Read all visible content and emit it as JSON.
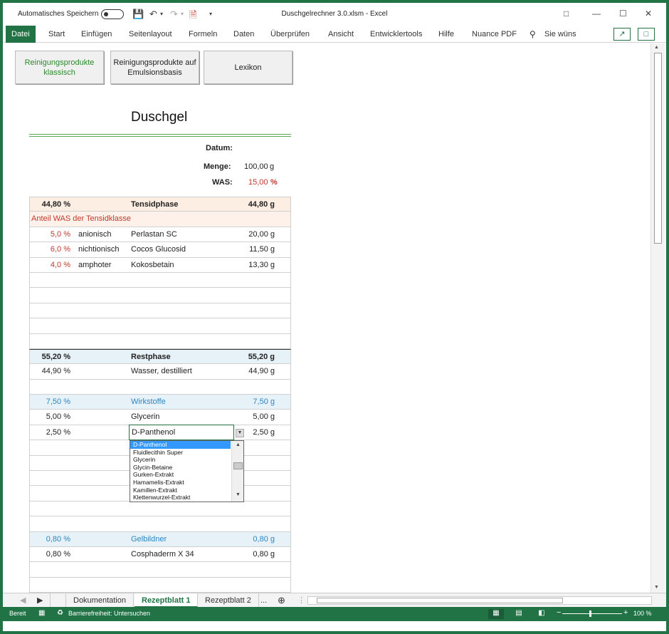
{
  "titlebar": {
    "autosave_label": "Automatisches Speichern",
    "title": "Duschgelrechner 3.0.xlsm  -  Excel"
  },
  "ribbon": {
    "tabs": [
      "Datei",
      "Start",
      "Einfügen",
      "Seitenlayout",
      "Formeln",
      "Daten",
      "Überprüfen",
      "Ansicht",
      "Entwicklertools",
      "Hilfe",
      "Nuance PDF"
    ],
    "search": "Sie wüns"
  },
  "buttons": {
    "classic": "Reinigungsprodukte klassisch",
    "emulsion": "Reinigungsprodukte auf Emulsionsbasis",
    "lexikon": "Lexikon"
  },
  "sheet": {
    "title": "Duschgel",
    "datum_label": "Datum:",
    "menge_label": "Menge:",
    "menge_value": "100,00",
    "menge_unit": "g",
    "was_label": "WAS:",
    "was_value": "15,00",
    "was_unit": "%"
  },
  "tensid": {
    "pct": "44,80 %",
    "name": "Tensidphase",
    "amount": "44,80 g",
    "note": "Anteil WAS der Tensidklasse",
    "items": [
      {
        "pct": "5,0 %",
        "class": "anionisch",
        "name": "Perlastan SC",
        "amount": "20,00 g"
      },
      {
        "pct": "6,0 %",
        "class": "nichtionisch",
        "name": "Cocos Glucosid",
        "amount": "11,50 g"
      },
      {
        "pct": "4,0 %",
        "class": "amphoter",
        "name": "Kokosbetain",
        "amount": "13,30 g"
      }
    ]
  },
  "rest": {
    "pct": "55,20 %",
    "name": "Restphase",
    "amount": "55,20 g",
    "items": [
      {
        "pct": "44,90 %",
        "name": "Wasser, destilliert",
        "amount": "44,90 g"
      }
    ]
  },
  "wirk": {
    "pct": "7,50 %",
    "name": "Wirkstoffe",
    "amount": "7,50 g",
    "items": [
      {
        "pct": "5,00 %",
        "name": "Glycerin",
        "amount": "5,00 g"
      },
      {
        "pct": "2,50 %",
        "name": "D-Panthenol",
        "amount": "2,50 g"
      }
    ]
  },
  "gelb": {
    "pct": "0,80 %",
    "name": "Gelbildner",
    "amount": "0,80 g",
    "items": [
      {
        "pct": "0,80 %",
        "name": "Cosphaderm X 34",
        "amount": "0,80 g"
      }
    ]
  },
  "dropdown": {
    "value": "D-Panthenol",
    "options": [
      "D-Panthenol",
      "Fluidlecithin Super",
      "Glycerin",
      "Glycin-Betaine",
      "Gurken-Extrakt",
      "Hamamelis-Extrakt",
      "Kamillen-Extrakt",
      "Klettenwurzel-Extrakt"
    ]
  },
  "sheettabs": {
    "tabs": [
      "Dokumentation",
      "Rezeptblatt 1",
      "Rezeptblatt 2"
    ],
    "more": "..."
  },
  "status": {
    "ready": "Bereit",
    "accessibility": "Barrierefreiheit: Untersuchen",
    "zoom": "100 %"
  },
  "colors": {
    "excel_green": "#217346",
    "red_text": "#c0392b",
    "blue_text": "#2e86c1"
  }
}
